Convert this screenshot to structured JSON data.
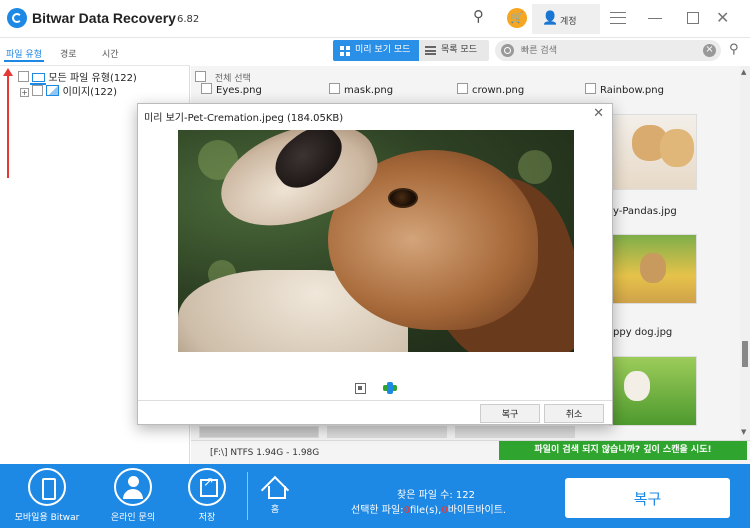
{
  "app": {
    "title": "Bitwar Data Recovery",
    "version": "6.82",
    "account_label": "계정"
  },
  "left_tabs": [
    "파일 유형",
    "경로",
    "시간"
  ],
  "tree": [
    {
      "label": "모든 파일 유형",
      "count": "(122)"
    },
    {
      "label": "이미지",
      "count": "(122)"
    }
  ],
  "toolbar": {
    "preview_mode": "미리 보기 모드",
    "list_mode": "목록 모드",
    "search_placeholder": "빠른 검색"
  },
  "grid": {
    "select_all": "전체 선택",
    "row1": [
      "Eyes.png",
      "mask.png",
      "crown.png",
      "Rainbow.png"
    ],
    "visible_right": [
      "y-Pandas.jpg",
      "ppy dog.jpg"
    ]
  },
  "dialog": {
    "title": "미리 보기-Pet-Cremation.jpeg (184.05KB)",
    "recover": "복구",
    "cancel": "취소"
  },
  "status": {
    "path": "[F:\\] NTFS 1.94G - 1.98G",
    "deep_scan": "파일이 검색 되지 않습니까? 깊이 스캔을 시도!"
  },
  "bottom": {
    "mobile": "모바일용 Bitwar",
    "online": "온라인 문의",
    "save": "저장",
    "home": "홈",
    "found_label": "찾은 파일 수:",
    "found_value": "122",
    "selected_prefix": "선택한 파일:",
    "selected_files": "0",
    "selected_mid": "file(s),",
    "selected_bytes": "0",
    "selected_suffix": "바이트바이트.",
    "recover_button": "복구"
  }
}
